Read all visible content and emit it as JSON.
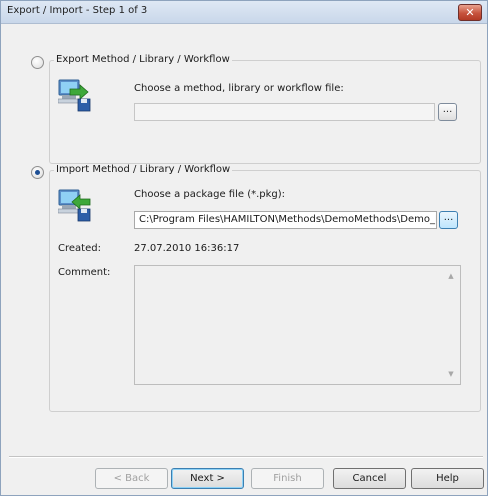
{
  "window": {
    "title": "Export / Import - Step 1 of 3",
    "close_label": "✕"
  },
  "export_group": {
    "legend": "Export Method / Library / Workflow",
    "selected": false,
    "prompt": "Choose a method, library or workflow file:",
    "file_value": "",
    "browse_label": "..."
  },
  "import_group": {
    "legend": "Import Method / Library / Workflow",
    "selected": true,
    "prompt": "Choose a package file (*.pkg):",
    "file_value": "C:\\Program Files\\HAMILTON\\Methods\\DemoMethods\\Demo_Dis",
    "browse_label": "...",
    "created_label": "Created:",
    "created_value": "27.07.2010 16:36:17",
    "comment_label": "Comment:",
    "comment_value": ""
  },
  "buttons": {
    "back": "< Back",
    "next": "Next >",
    "finish": "Finish",
    "cancel": "Cancel",
    "help": "Help"
  },
  "icons": {
    "export": "computer-export-arrow-icon",
    "import": "computer-import-arrow-icon"
  },
  "colors": {
    "accent": "#1d4f95",
    "close_button": "#c7533d"
  }
}
